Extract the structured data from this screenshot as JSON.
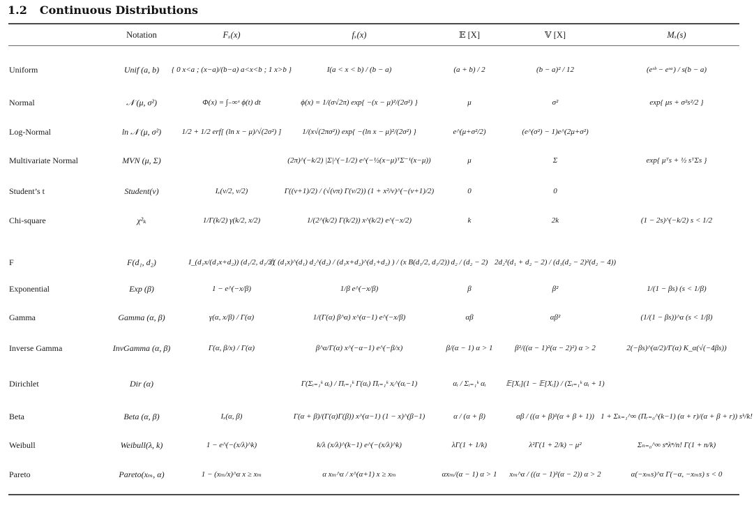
{
  "section": {
    "number": "1.2",
    "title": "Continuous Distributions"
  },
  "columns": [
    "",
    "Notation",
    "F_X(x)",
    "f_X(x)",
    "𝔼[X]",
    "𝕍[X]",
    "M_X(s)"
  ],
  "header": {
    "notation": "Notation",
    "cdf": "Fₓ(x)",
    "pdf": "fₓ(x)",
    "mean": "𝔼 [X]",
    "variance": "𝕍 [X]",
    "mgf": "Mₓ(s)"
  },
  "rows": [
    {
      "name": "Uniform",
      "notation": "Unif (a, b)",
      "cdf": "{ 0  x<a ; (x−a)/(b−a)  a<x<b ; 1  x>b }",
      "pdf": "I(a < x < b) / (b − a)",
      "mean": "(a + b) / 2",
      "variance": "(b − a)² / 12",
      "mgf": "(eˢᵇ − eˢᵃ) / s(b − a)"
    },
    {
      "name": "Normal",
      "notation": "𝒩 (μ, σ²)",
      "cdf": "Φ(x) = ∫₋∞ˣ ϕ(t) dt",
      "pdf": "ϕ(x) = 1/(σ√2π) exp{ −(x − μ)²/(2σ²) }",
      "mean": "μ",
      "variance": "σ²",
      "mgf": "exp{ μs + σ²s²/2 }"
    },
    {
      "name": "Log-Normal",
      "notation": "ln 𝒩 (μ, σ²)",
      "cdf": "1/2 + 1/2 erf[ (ln x − μ)/√(2σ²) ]",
      "pdf": "1/(x√(2πσ²)) exp{ −(ln x − μ)²/(2σ²) }",
      "mean": "e^(μ+σ²/2)",
      "variance": "(e^(σ²) − 1)e^(2μ+σ²)",
      "mgf": ""
    },
    {
      "name": "Multivariate Normal",
      "notation": "MVN (μ, Σ)",
      "cdf": "",
      "pdf": "(2π)^(−k/2) |Σ|^(−1/2) e^(−½(x−μ)ᵀΣ⁻¹(x−μ))",
      "mean": "μ",
      "variance": "Σ",
      "mgf": "exp{ μᵀs + ½ sᵀΣs }"
    },
    {
      "name": "Student’s t",
      "notation": "Student(ν)",
      "cdf": "Iₓ(ν/2, ν/2)",
      "pdf": "Γ((ν+1)/2) / (√(νπ) Γ(ν/2)) (1 + x²/ν)^(−(ν+1)/2)",
      "mean": "0",
      "variance": "0",
      "mgf": ""
    },
    {
      "name": "Chi-square",
      "notation": "χ²ₖ",
      "cdf": "1/Γ(k/2) γ(k/2, x/2)",
      "pdf": "1/(2^(k/2) Γ(k/2)) x^(k/2) e^(−x/2)",
      "mean": "k",
      "variance": "2k",
      "mgf": "(1 − 2s)^(−k/2) s < 1/2"
    },
    {
      "name": "F",
      "notation": "F(d₁, d₂)",
      "cdf": "I_(d₁x/(d₁x+d₂)) (d₁/2, d₁/2)",
      "pdf": "√( (d₁x)^(d₁) d₂^(d₂) / (d₁x+d₂)^(d₁+d₂) ) / (x B(d₁/2, d₁/2))",
      "mean": "d₂ / (d₂ − 2)",
      "variance": "2d₂²(d₁ + d₂ − 2) / (d₁(d₂ − 2)²(d₂ − 4))",
      "mgf": ""
    },
    {
      "name": "Exponential",
      "notation": "Exp (β)",
      "cdf": "1 − e^(−x/β)",
      "pdf": "1/β e^(−x/β)",
      "mean": "β",
      "variance": "β²",
      "mgf": "1/(1 − βs) (s < 1/β)"
    },
    {
      "name": "Gamma",
      "notation": "Gamma (α, β)",
      "cdf": "γ(α, x/β) / Γ(α)",
      "pdf": "1/(Γ(α) β^α) x^(α−1) e^(−x/β)",
      "mean": "αβ",
      "variance": "αβ²",
      "mgf": "(1/(1 − βs))^α (s < 1/β)"
    },
    {
      "name": "Inverse Gamma",
      "notation": "InvGamma (α, β)",
      "cdf": "Γ(α, β/x) / Γ(α)",
      "pdf": "β^α/Γ(α) x^(−α−1) e^(−β/x)",
      "mean": "β/(α − 1) α > 1",
      "variance": "β²/((α − 1)²(α − 2)²) α > 2",
      "mgf": "2(−βs)^(α/2)/Γ(α) K_α(√(−4βs))"
    },
    {
      "name": "Dirichlet",
      "notation": "Dir (α)",
      "cdf": "",
      "pdf": "Γ(Σᵢ₌₁ᵏ αᵢ) / Πᵢ₌₁ᵏ Γ(αᵢ) Πᵢ₌₁ᵏ xᵢ^(αᵢ−1)",
      "mean": "αᵢ / Σᵢ₌₁ᵏ αᵢ",
      "variance": "𝔼[Xᵢ](1 − 𝔼[Xᵢ]) / (Σᵢ₌₁ᵏ αᵢ + 1)",
      "mgf": ""
    },
    {
      "name": "Beta",
      "notation": "Beta (α, β)",
      "cdf": "Iₓ(α, β)",
      "pdf": "Γ(α + β)/(Γ(α)Γ(β)) x^(α−1) (1 − x)^(β−1)",
      "mean": "α / (α + β)",
      "variance": "αβ / ((α + β)²(α + β + 1))",
      "mgf": "1 + Σₖ₌₁^∞ (Πᵣ₌₀^(k−1) (α + r)/(α + β + r)) sᵏ/k!"
    },
    {
      "name": "Weibull",
      "notation": "Weibull(λ, k)",
      "cdf": "1 − e^(−(x/λ)^k)",
      "pdf": "k/λ (x/λ)^(k−1) e^(−(x/λ)^k)",
      "mean": "λΓ(1 + 1/k)",
      "variance": "λ²Γ(1 + 2/k) − μ²",
      "mgf": "Σₙ₌₀^∞ sⁿλⁿ/n! Γ(1 + n/k)"
    },
    {
      "name": "Pareto",
      "notation": "Pareto(xₘ, α)",
      "cdf": "1 − (xₘ/x)^α x ≥ xₘ",
      "pdf": "α xₘ^α / x^(α+1)  x ≥ xₘ",
      "mean": "αxₘ/(α − 1) α > 1",
      "variance": "xₘ^α / ((α − 1)²(α − 2)) α > 2",
      "mgf": "α(−xₘs)^α Γ(−α, −xₘs) s < 0"
    }
  ]
}
